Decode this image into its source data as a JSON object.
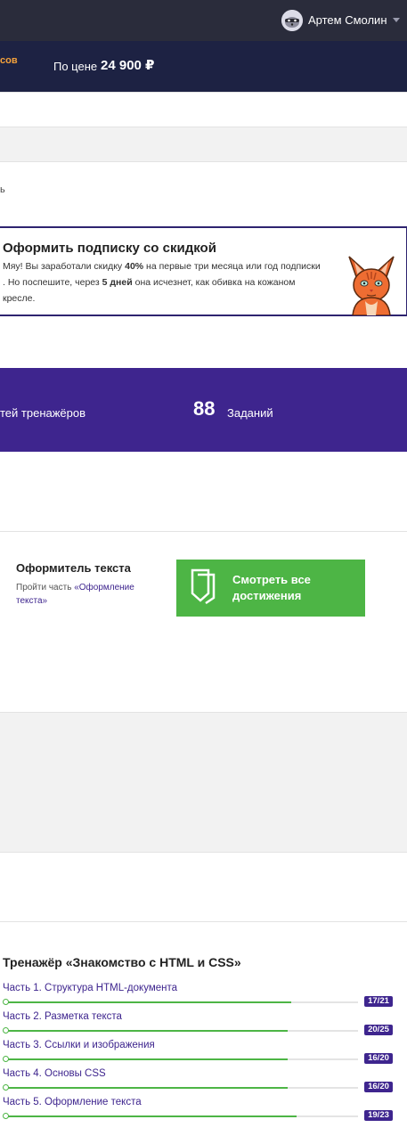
{
  "header": {
    "user_name": "Артем Смолин",
    "avatar_icon": "raccoon-avatar-icon",
    "dropdown_icon": "chevron-down-icon"
  },
  "price_banner": {
    "left_fragment": "сов",
    "price_label": "По цене",
    "price_value": "24 900 ₽"
  },
  "fragment_text": "ь",
  "promo": {
    "title": "Оформить подписку со скидкой",
    "text_1": "Мяу! Вы заработали скидку ",
    "discount": "40%",
    "text_2": " на первые три месяца или год подписки . Но поспешите, через ",
    "days": "5 дней",
    "text_3": " она исчезнет, как обивка на кожаном кресле.",
    "illustration_icon": "orange-cat-icon"
  },
  "stats": {
    "label_left": "тей тренажёров",
    "tasks_count": "88",
    "tasks_label": "Заданий"
  },
  "achievement": {
    "title": "Оформитель текста",
    "desc_prefix": "Пройти часть ",
    "desc_link": "«Оформление текста»",
    "button_label": "Смотреть все достижения",
    "button_icon": "badge-shield-icon"
  },
  "trainer": {
    "title": "Тренажёр «Знакомство с HTML и CSS»",
    "parts": [
      {
        "label": "Часть 1. Структура HTML-документа",
        "progress": "17/21",
        "done": 17,
        "total": 21
      },
      {
        "label": "Часть 2. Разметка текста",
        "progress": "20/25",
        "done": 20,
        "total": 25
      },
      {
        "label": "Часть 3. Ссылки и изображения",
        "progress": "16/20",
        "done": 16,
        "total": 20
      },
      {
        "label": "Часть 4. Основы CSS",
        "progress": "16/20",
        "done": 16,
        "total": 20
      },
      {
        "label": "Часть 5. Оформление текста",
        "progress": "19/23",
        "done": 19,
        "total": 23
      }
    ]
  },
  "colors": {
    "header_bg": "#2a2c3b",
    "banner_bg": "#1d2243",
    "accent_purple": "#3e258e",
    "accent_green": "#4db545",
    "accent_orange": "#f7a33b"
  }
}
